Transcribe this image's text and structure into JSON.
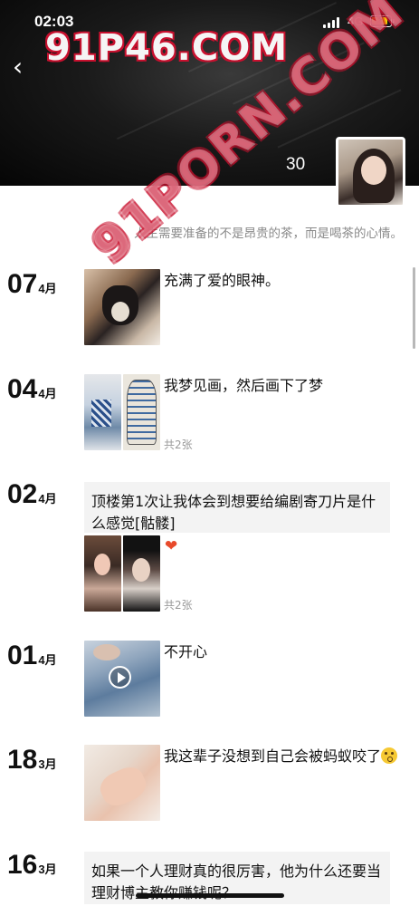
{
  "status_bar": {
    "time": "02:03",
    "network": "4G",
    "battery_level": 0.7
  },
  "header": {
    "back_icon": "chevron-left-icon",
    "watermark": "91P46.COM",
    "count": "30",
    "signature": "人生需要准备的不是昂贵的茶，而是喝茶的心情。"
  },
  "watermark_overlay": "91PORN.COM",
  "posts": [
    {
      "day": "07",
      "month": "4月",
      "caption": "充满了爱的眼神。"
    },
    {
      "day": "04",
      "month": "4月",
      "caption": "我梦见画，然后画下了梦",
      "count": "共2张"
    },
    {
      "day": "02",
      "month": "4月",
      "text": "顶楼第1次让我体会到想要给编剧寄刀片是什么感觉[骷髅]",
      "reaction_icon": "heart-icon",
      "count": "共2张"
    },
    {
      "day": "01",
      "month": "4月",
      "caption": "不开心",
      "media_icon": "play-icon"
    },
    {
      "day": "18",
      "month": "3月",
      "caption": "我这辈子没想到自己会被蚂蚁咬了",
      "emoji_icon": "flushed-face-icon"
    },
    {
      "day": "16",
      "month": "3月",
      "text": "如果一个人理财真的很厉害，他为什么还要当理财博主教你赚钱呢？..."
    }
  ]
}
